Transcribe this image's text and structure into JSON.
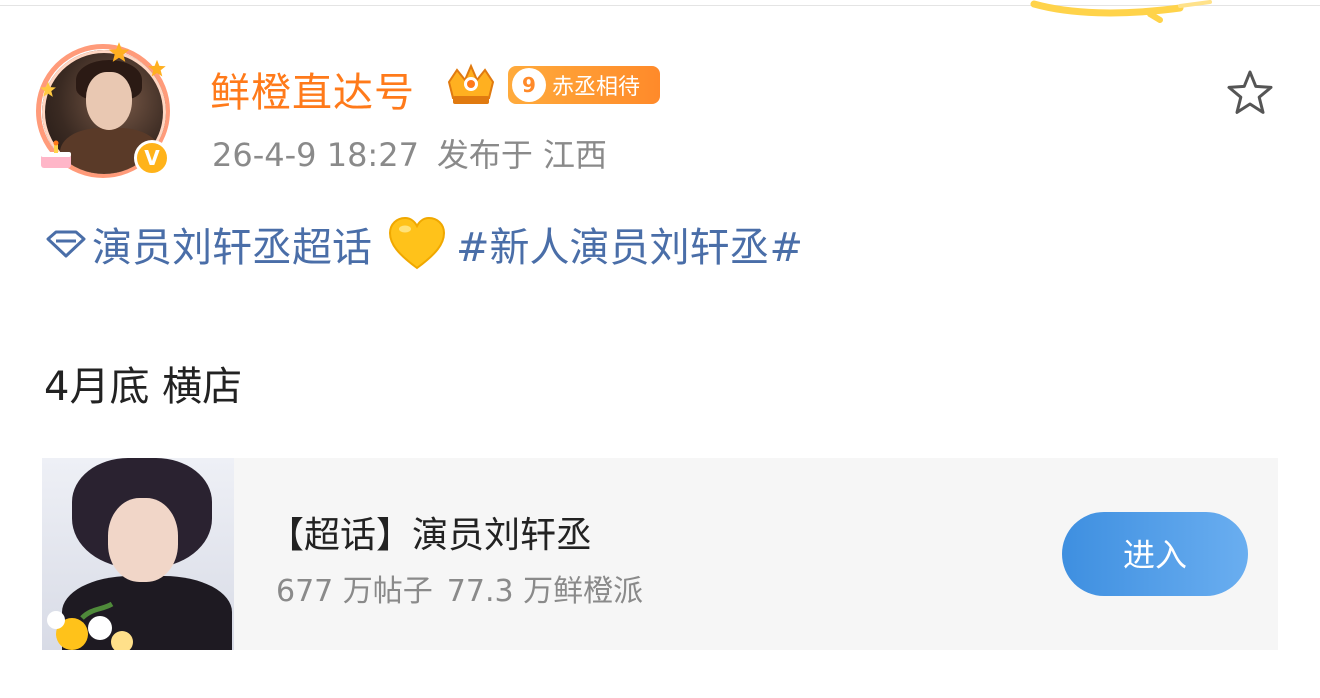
{
  "post": {
    "author": {
      "name": "鲜橙直达号",
      "level_number": "9",
      "level_title": "赤丞相待",
      "verified_mark": "V"
    },
    "timestamp": "26-4-9 18:27",
    "location_prefix": "发布于",
    "location": "江西",
    "topic_tag": "演员刘轩丞超话",
    "hashtag": "#新人演员刘轩丞#",
    "text": "4月底 横店"
  },
  "card": {
    "title": "【超话】演员刘轩丞",
    "posts_count": "677 万帖子",
    "fans_count": "77.3 万鲜橙派",
    "enter_label": "进入"
  },
  "icons": {
    "topic": "diamond-icon",
    "emoji": "yellow-heart-icon",
    "favorite": "star-outline-icon",
    "badge": "crown-badge-icon"
  },
  "colors": {
    "username": "#ff7a1a",
    "topic_link": "#4a6ea8",
    "enter_button": "#4a9be6",
    "meta_text": "#8a8a8a"
  }
}
